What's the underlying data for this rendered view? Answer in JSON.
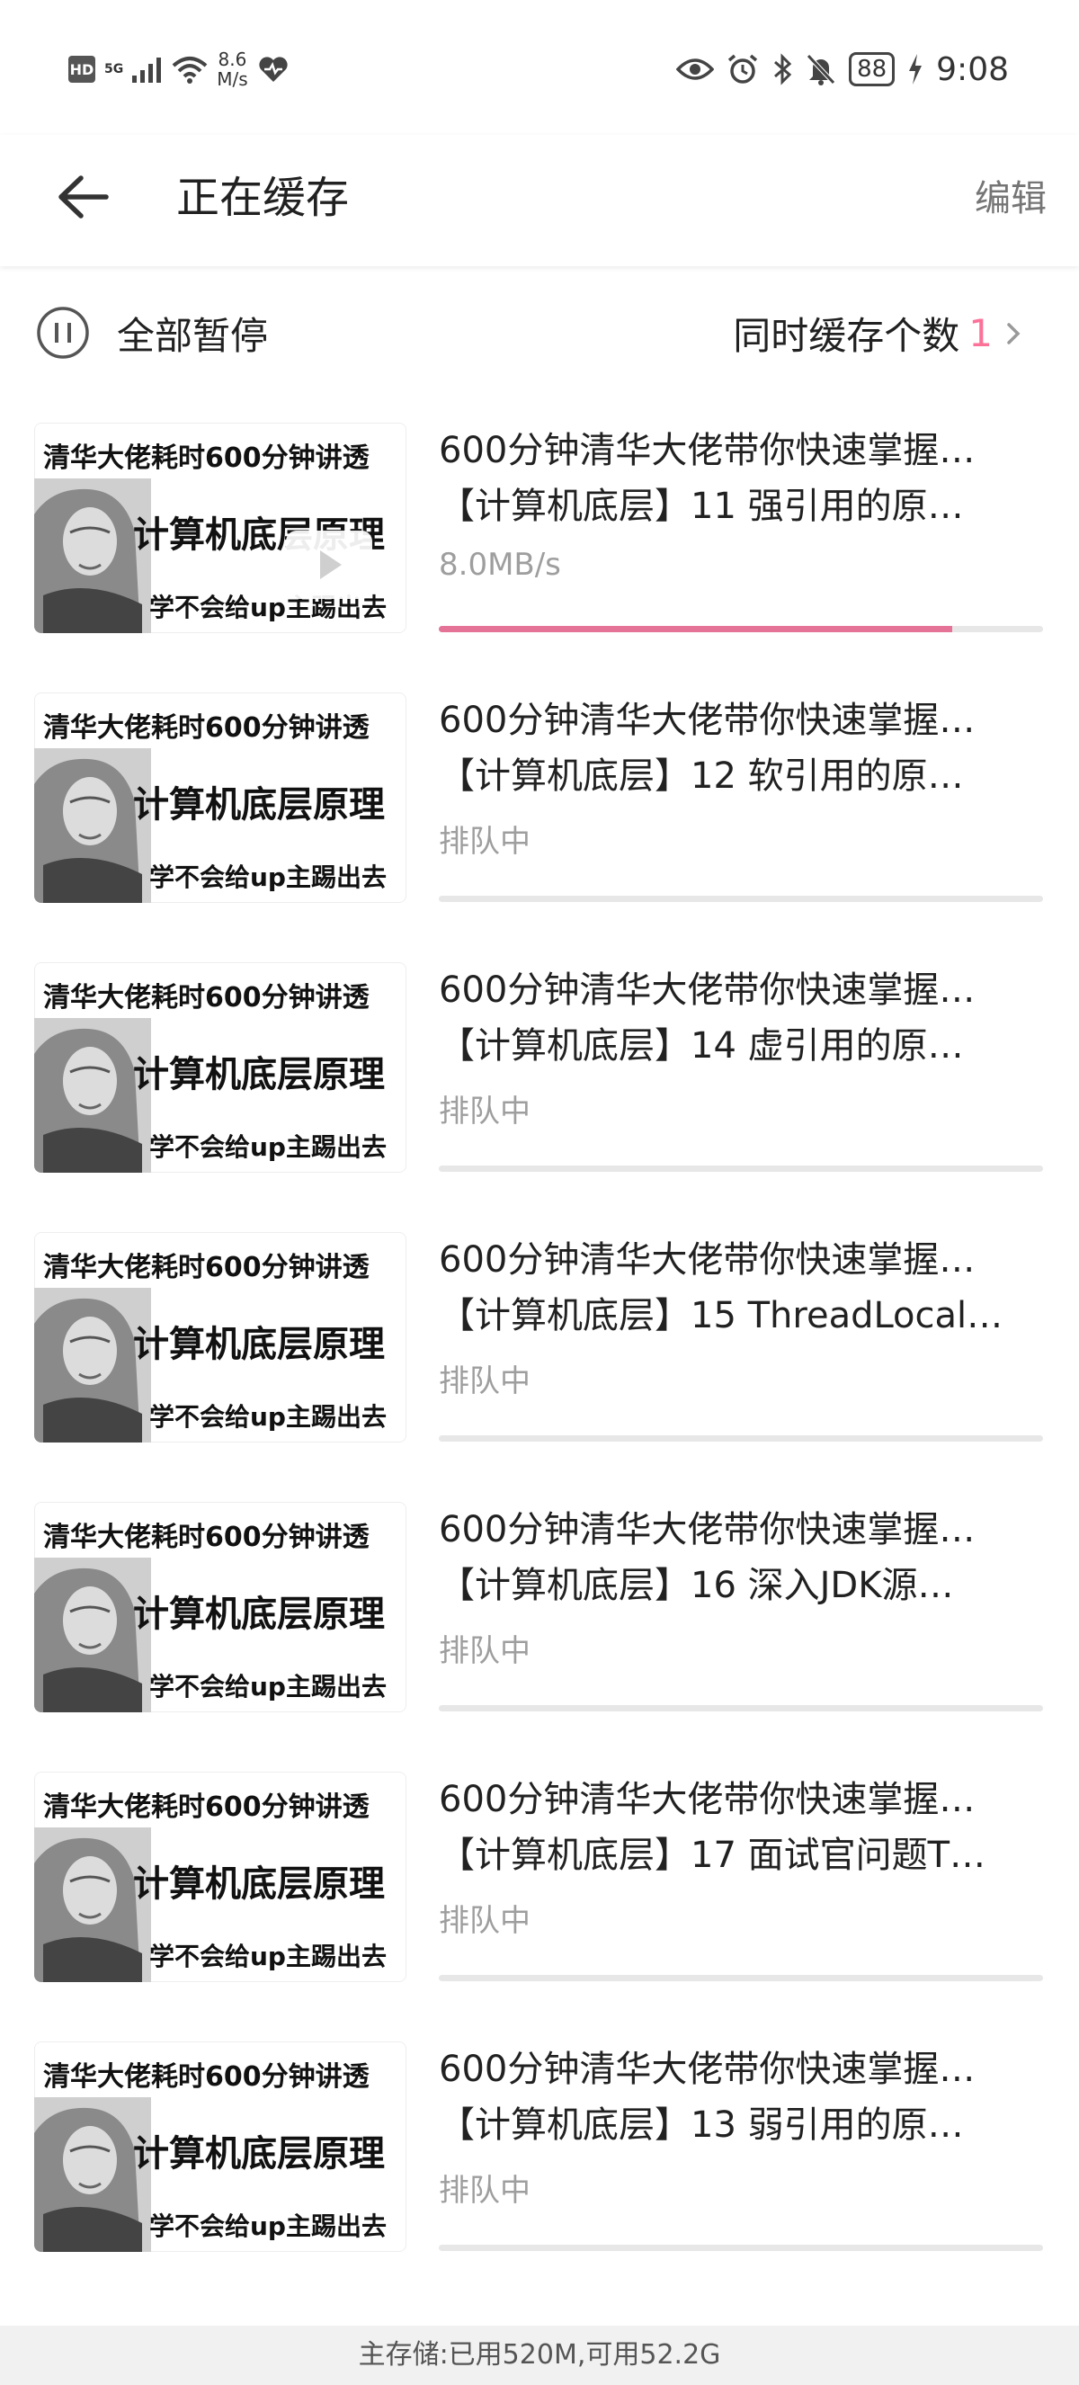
{
  "status_bar": {
    "hd": "HD",
    "network": "5G",
    "speed_value": "8.6",
    "speed_unit": "M/s",
    "battery": "88",
    "time": "9:08"
  },
  "header": {
    "title": "正在缓存",
    "edit": "编辑"
  },
  "controls": {
    "pause_all": "全部暂停",
    "concurrent_label": "同时缓存个数",
    "concurrent_value": "1"
  },
  "thumbnail": {
    "line1": "清华大佬耗时600分钟讲透",
    "line2": "计算机底层原理",
    "line3": "学不会给up主踢出去"
  },
  "items": [
    {
      "title": "600分钟清华大佬带你快速掌握…",
      "subtitle": "【计算机底层】11 强引用的原…",
      "status": "8.0MB/s",
      "progress": 0.85,
      "playing": true
    },
    {
      "title": "600分钟清华大佬带你快速掌握…",
      "subtitle": "【计算机底层】12 软引用的原…",
      "status": "排队中",
      "progress": 0,
      "playing": false
    },
    {
      "title": "600分钟清华大佬带你快速掌握…",
      "subtitle": "【计算机底层】14 虚引用的原…",
      "status": "排队中",
      "progress": 0,
      "playing": false
    },
    {
      "title": "600分钟清华大佬带你快速掌握…",
      "subtitle": "【计算机底层】15 ThreadLocal…",
      "status": "排队中",
      "progress": 0,
      "playing": false
    },
    {
      "title": "600分钟清华大佬带你快速掌握…",
      "subtitle": "【计算机底层】16 深入JDK源…",
      "status": "排队中",
      "progress": 0,
      "playing": false
    },
    {
      "title": "600分钟清华大佬带你快速掌握…",
      "subtitle": "【计算机底层】17 面试官问题T…",
      "status": "排队中",
      "progress": 0,
      "playing": false
    },
    {
      "title": "600分钟清华大佬带你快速掌握…",
      "subtitle": "【计算机底层】13 弱引用的原…",
      "status": "排队中",
      "progress": 0,
      "playing": false
    }
  ],
  "footer": {
    "storage": "主存储:已用520M,可用52.2G"
  },
  "colors": {
    "accent": "#fb7299",
    "progress": "#e47397",
    "track": "#e7e7e7"
  }
}
